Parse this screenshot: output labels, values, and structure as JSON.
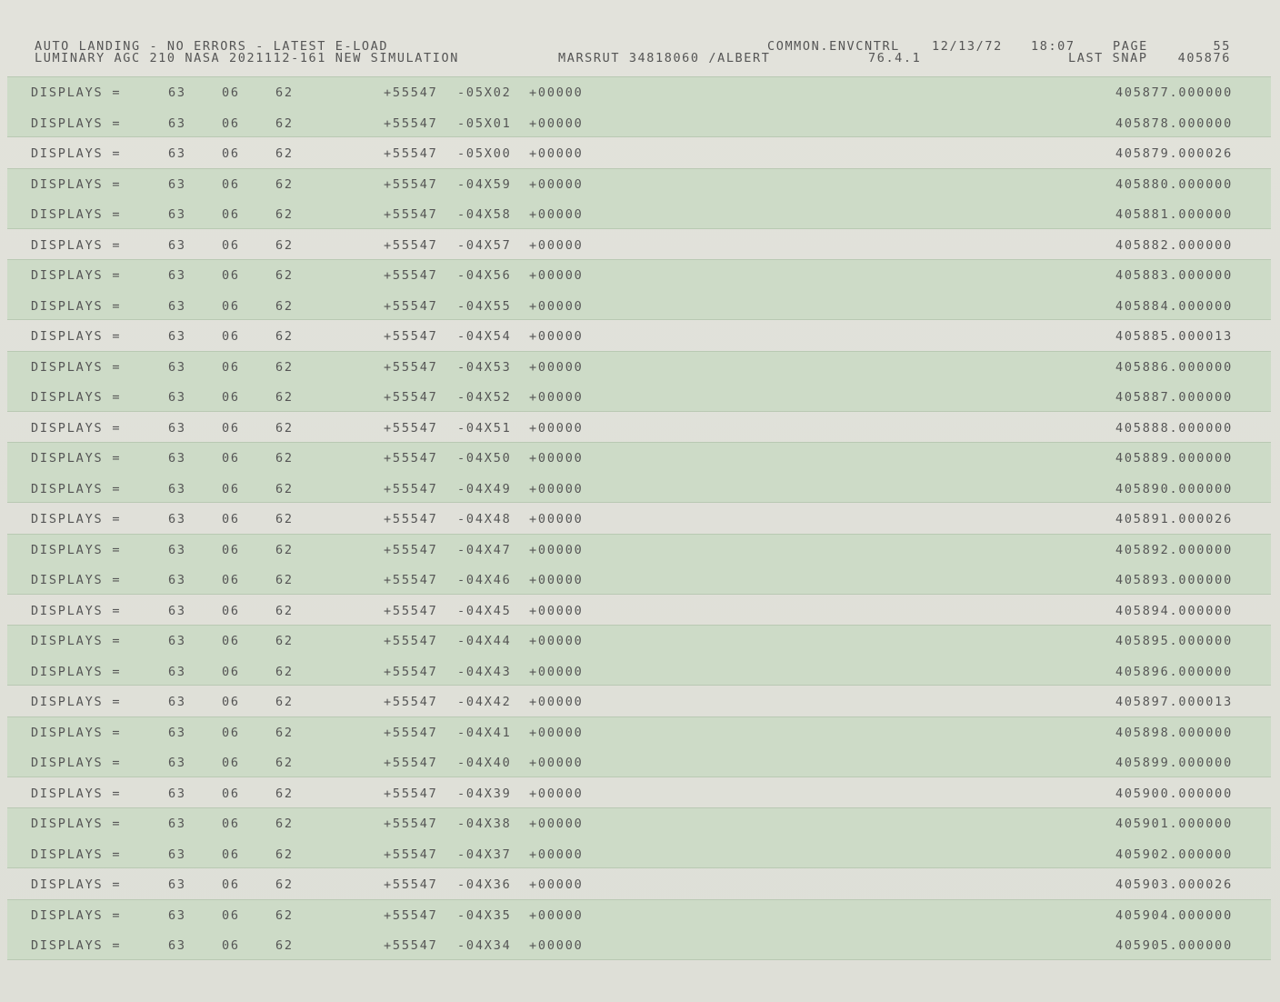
{
  "header": {
    "line1_left": "AUTO LANDING - NO ERRORS - LATEST E-LOAD",
    "line2_left": "LUMINARY AGC    210   NASA 2021112-161 NEW SIMULATION",
    "line2_mid": "MARSRUT 34818060 /ALBERT",
    "common": "COMMON.ENVCNTRL",
    "version": "76.4.1",
    "date": "12/13/72",
    "time": "18:07",
    "page_label": "PAGE",
    "page_number": "55",
    "last_snap_label": "LAST SNAP",
    "last_snap_value": "405876"
  },
  "rows": [
    {
      "label": "DISPLAYS =",
      "a": "63",
      "b": "06",
      "c": "62",
      "d": "+55547",
      "e": "-05X02",
      "f": "+00000",
      "snap": "405877.000000"
    },
    {
      "label": "DISPLAYS =",
      "a": "63",
      "b": "06",
      "c": "62",
      "d": "+55547",
      "e": "-05X01",
      "f": "+00000",
      "snap": "405878.000000"
    },
    {
      "label": "DISPLAYS =",
      "a": "63",
      "b": "06",
      "c": "62",
      "d": "+55547",
      "e": "-05X00",
      "f": "+00000",
      "snap": "405879.000026"
    },
    {
      "label": "DISPLAYS =",
      "a": "63",
      "b": "06",
      "c": "62",
      "d": "+55547",
      "e": "-04X59",
      "f": "+00000",
      "snap": "405880.000000"
    },
    {
      "label": "DISPLAYS =",
      "a": "63",
      "b": "06",
      "c": "62",
      "d": "+55547",
      "e": "-04X58",
      "f": "+00000",
      "snap": "405881.000000"
    },
    {
      "label": "DISPLAYS =",
      "a": "63",
      "b": "06",
      "c": "62",
      "d": "+55547",
      "e": "-04X57",
      "f": "+00000",
      "snap": "405882.000000"
    },
    {
      "label": "DISPLAYS =",
      "a": "63",
      "b": "06",
      "c": "62",
      "d": "+55547",
      "e": "-04X56",
      "f": "+00000",
      "snap": "405883.000000"
    },
    {
      "label": "DISPLAYS =",
      "a": "63",
      "b": "06",
      "c": "62",
      "d": "+55547",
      "e": "-04X55",
      "f": "+00000",
      "snap": "405884.000000"
    },
    {
      "label": "DISPLAYS =",
      "a": "63",
      "b": "06",
      "c": "62",
      "d": "+55547",
      "e": "-04X54",
      "f": "+00000",
      "snap": "405885.000013"
    },
    {
      "label": "DISPLAYS =",
      "a": "63",
      "b": "06",
      "c": "62",
      "d": "+55547",
      "e": "-04X53",
      "f": "+00000",
      "snap": "405886.000000"
    },
    {
      "label": "DISPLAYS =",
      "a": "63",
      "b": "06",
      "c": "62",
      "d": "+55547",
      "e": "-04X52",
      "f": "+00000",
      "snap": "405887.000000"
    },
    {
      "label": "DISPLAYS =",
      "a": "63",
      "b": "06",
      "c": "62",
      "d": "+55547",
      "e": "-04X51",
      "f": "+00000",
      "snap": "405888.000000"
    },
    {
      "label": "DISPLAYS =",
      "a": "63",
      "b": "06",
      "c": "62",
      "d": "+55547",
      "e": "-04X50",
      "f": "+00000",
      "snap": "405889.000000"
    },
    {
      "label": "DISPLAYS =",
      "a": "63",
      "b": "06",
      "c": "62",
      "d": "+55547",
      "e": "-04X49",
      "f": "+00000",
      "snap": "405890.000000"
    },
    {
      "label": "DISPLAYS =",
      "a": "63",
      "b": "06",
      "c": "62",
      "d": "+55547",
      "e": "-04X48",
      "f": "+00000",
      "snap": "405891.000026"
    },
    {
      "label": "DISPLAYS =",
      "a": "63",
      "b": "06",
      "c": "62",
      "d": "+55547",
      "e": "-04X47",
      "f": "+00000",
      "snap": "405892.000000"
    },
    {
      "label": "DISPLAYS =",
      "a": "63",
      "b": "06",
      "c": "62",
      "d": "+55547",
      "e": "-04X46",
      "f": "+00000",
      "snap": "405893.000000"
    },
    {
      "label": "DISPLAYS =",
      "a": "63",
      "b": "06",
      "c": "62",
      "d": "+55547",
      "e": "-04X45",
      "f": "+00000",
      "snap": "405894.000000"
    },
    {
      "label": "DISPLAYS =",
      "a": "63",
      "b": "06",
      "c": "62",
      "d": "+55547",
      "e": "-04X44",
      "f": "+00000",
      "snap": "405895.000000"
    },
    {
      "label": "DISPLAYS =",
      "a": "63",
      "b": "06",
      "c": "62",
      "d": "+55547",
      "e": "-04X43",
      "f": "+00000",
      "snap": "405896.000000"
    },
    {
      "label": "DISPLAYS =",
      "a": "63",
      "b": "06",
      "c": "62",
      "d": "+55547",
      "e": "-04X42",
      "f": "+00000",
      "snap": "405897.000013"
    },
    {
      "label": "DISPLAYS =",
      "a": "63",
      "b": "06",
      "c": "62",
      "d": "+55547",
      "e": "-04X41",
      "f": "+00000",
      "snap": "405898.000000"
    },
    {
      "label": "DISPLAYS =",
      "a": "63",
      "b": "06",
      "c": "62",
      "d": "+55547",
      "e": "-04X40",
      "f": "+00000",
      "snap": "405899.000000"
    },
    {
      "label": "DISPLAYS =",
      "a": "63",
      "b": "06",
      "c": "62",
      "d": "+55547",
      "e": "-04X39",
      "f": "+00000",
      "snap": "405900.000000"
    },
    {
      "label": "DISPLAYS =",
      "a": "63",
      "b": "06",
      "c": "62",
      "d": "+55547",
      "e": "-04X38",
      "f": "+00000",
      "snap": "405901.000000"
    },
    {
      "label": "DISPLAYS =",
      "a": "63",
      "b": "06",
      "c": "62",
      "d": "+55547",
      "e": "-04X37",
      "f": "+00000",
      "snap": "405902.000000"
    },
    {
      "label": "DISPLAYS =",
      "a": "63",
      "b": "06",
      "c": "62",
      "d": "+55547",
      "e": "-04X36",
      "f": "+00000",
      "snap": "405903.000026"
    },
    {
      "label": "DISPLAYS =",
      "a": "63",
      "b": "06",
      "c": "62",
      "d": "+55547",
      "e": "-04X35",
      "f": "+00000",
      "snap": "405904.000000"
    },
    {
      "label": "DISPLAYS =",
      "a": "63",
      "b": "06",
      "c": "62",
      "d": "+55547",
      "e": "-04X34",
      "f": "+00000",
      "snap": "405905.000000"
    }
  ],
  "colors": {
    "paper": "#e2e2db",
    "greenbar": "#cddbc7",
    "ink": "#555555"
  }
}
